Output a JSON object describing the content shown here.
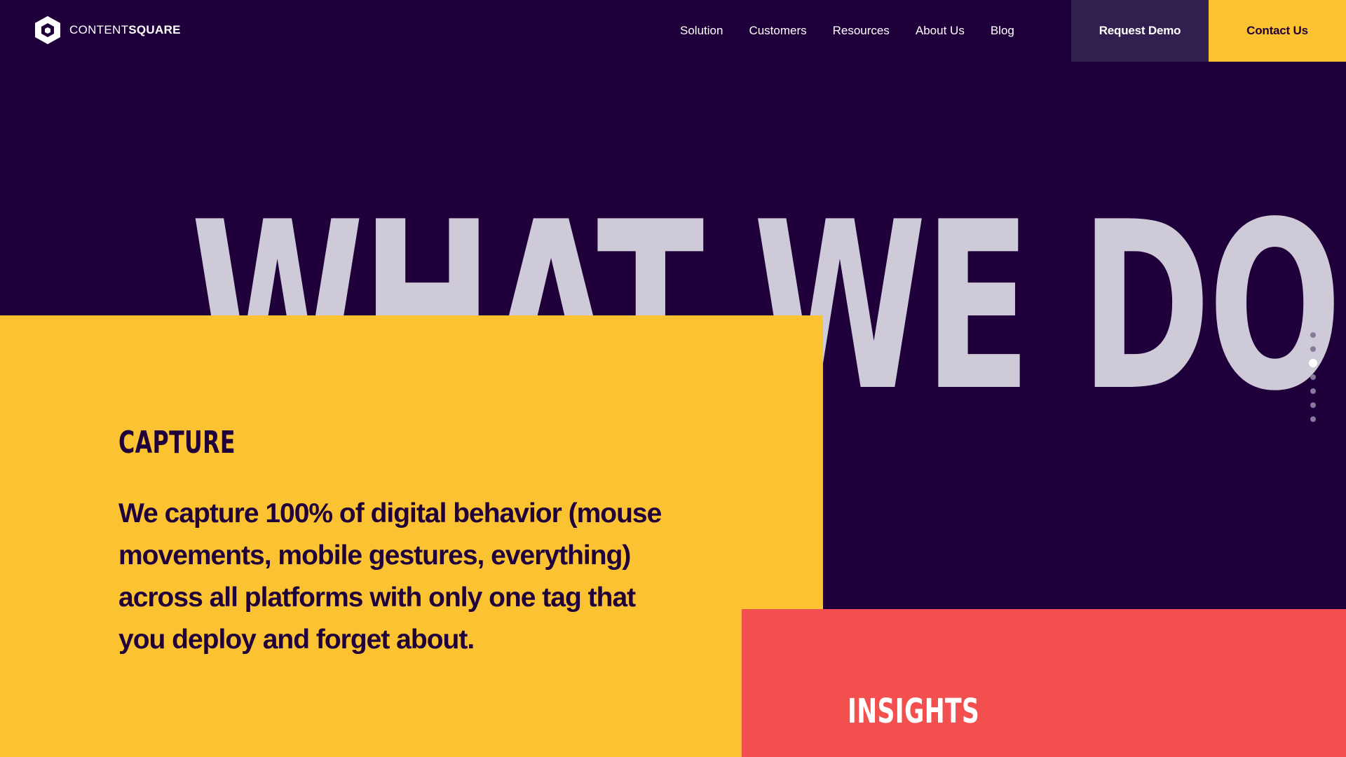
{
  "brand": {
    "name_light": "CONTENT",
    "name_bold": "SQUARE",
    "logo_icon": "hexagon-cube-icon"
  },
  "nav": {
    "items": [
      {
        "label": "Solution"
      },
      {
        "label": "Customers"
      },
      {
        "label": "Resources"
      },
      {
        "label": "About Us"
      },
      {
        "label": "Blog"
      }
    ],
    "request_demo": "Request Demo",
    "contact_us": "Contact Us"
  },
  "hero": {
    "title": "WHAT WE DO"
  },
  "capture": {
    "heading": "CAPTURE",
    "body": "We capture 100% of digital behavior (mouse movements, mobile gestures, everything) across all platforms with only one tag that you deploy and forget about."
  },
  "insights": {
    "heading": "INSIGHTS"
  },
  "section_dots": {
    "count": 7,
    "active_index": 2
  },
  "colors": {
    "background": "#1f003b",
    "yellow": "#fbc232",
    "red": "#f44f4f",
    "hero_text": "#cfcad8",
    "demo_button": "#30204f"
  }
}
